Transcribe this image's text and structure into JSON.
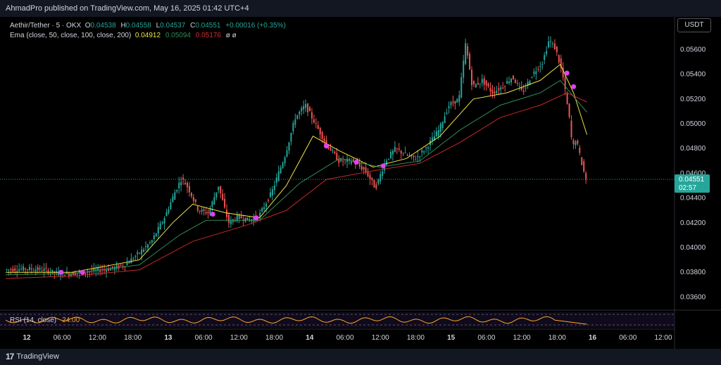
{
  "header": {
    "published": "AhmadPro published on TradingView.com, May 16, 2025 01:42 UTC+4"
  },
  "legend": {
    "symbol": "Aethir/Tether · 5 · OKX",
    "open_label": "O",
    "open": "0.04538",
    "high_label": "H",
    "high": "0.04558",
    "low_label": "L",
    "low": "0.04537",
    "close_label": "C",
    "close": "0.04551",
    "change": "+0.00016 (+0.35%)",
    "ema_label": "Ema (close, 50, close, 100, close, 200)",
    "ema_values": [
      "0.04912",
      "0.05094",
      "0.05176"
    ],
    "ema_extra": "ø ø"
  },
  "currency": "USDT",
  "price_tag": {
    "price": "0.04551",
    "countdown": "02:57"
  },
  "rsi": {
    "label": "RSI (14, close)",
    "value": "24.00"
  },
  "footer": {
    "brand": "TradingView"
  },
  "colors": {
    "up": "#26a69a",
    "down": "#ef5350",
    "ema50": "#f0e442",
    "ema100": "#2e8b57",
    "ema200": "#c62828",
    "signal": "#e040fb",
    "rsi": "#ffa726"
  },
  "chart_data": {
    "type": "line",
    "title": "",
    "ylim": [
      0.035,
      0.0575
    ],
    "y_ticks": [
      "0.05600",
      "0.05400",
      "0.05200",
      "0.05000",
      "0.04800",
      "0.04600",
      "0.04400",
      "0.04200",
      "0.04000",
      "0.03800",
      "0.03600"
    ],
    "x_ticks": [
      "12",
      "06:00",
      "12:00",
      "18:00",
      "13",
      "06:00",
      "12:00",
      "18:00",
      "14",
      "06:00",
      "12:00",
      "18:00",
      "15",
      "06:00",
      "12:00",
      "18:00",
      "16",
      "06:00",
      "12:00"
    ],
    "price_path": [
      [
        0,
        0.0382
      ],
      [
        0.03,
        0.0383
      ],
      [
        0.06,
        0.0382
      ],
      [
        0.08,
        0.0379
      ],
      [
        0.1,
        0.0379
      ],
      [
        0.13,
        0.0381
      ],
      [
        0.16,
        0.0383
      ],
      [
        0.18,
        0.0386
      ],
      [
        0.2,
        0.0395
      ],
      [
        0.22,
        0.0405
      ],
      [
        0.24,
        0.0425
      ],
      [
        0.255,
        0.0445
      ],
      [
        0.265,
        0.0456
      ],
      [
        0.275,
        0.0448
      ],
      [
        0.29,
        0.043
      ],
      [
        0.305,
        0.0428
      ],
      [
        0.32,
        0.045
      ],
      [
        0.335,
        0.042
      ],
      [
        0.35,
        0.0425
      ],
      [
        0.365,
        0.0422
      ],
      [
        0.38,
        0.0425
      ],
      [
        0.4,
        0.0445
      ],
      [
        0.42,
        0.0475
      ],
      [
        0.435,
        0.0505
      ],
      [
        0.45,
        0.0515
      ],
      [
        0.465,
        0.05
      ],
      [
        0.48,
        0.0485
      ],
      [
        0.5,
        0.047
      ],
      [
        0.52,
        0.047
      ],
      [
        0.54,
        0.0462
      ],
      [
        0.555,
        0.0448
      ],
      [
        0.57,
        0.047
      ],
      [
        0.585,
        0.048
      ],
      [
        0.6,
        0.0475
      ],
      [
        0.615,
        0.0472
      ],
      [
        0.63,
        0.048
      ],
      [
        0.65,
        0.0495
      ],
      [
        0.665,
        0.0515
      ],
      [
        0.68,
        0.052
      ],
      [
        0.69,
        0.0565
      ],
      [
        0.7,
        0.053
      ],
      [
        0.715,
        0.0535
      ],
      [
        0.73,
        0.0525
      ],
      [
        0.745,
        0.053
      ],
      [
        0.76,
        0.0538
      ],
      [
        0.775,
        0.0525
      ],
      [
        0.79,
        0.054
      ],
      [
        0.805,
        0.055
      ],
      [
        0.815,
        0.0568
      ],
      [
        0.825,
        0.056
      ],
      [
        0.835,
        0.054
      ],
      [
        0.845,
        0.0505
      ],
      [
        0.85,
        0.048
      ],
      [
        0.855,
        0.0488
      ],
      [
        0.865,
        0.0465
      ],
      [
        0.87,
        0.04551
      ]
    ],
    "series": [
      {
        "name": "Ema 50",
        "values": [
          [
            0,
            0.038
          ],
          [
            0.1,
            0.038
          ],
          [
            0.2,
            0.039
          ],
          [
            0.25,
            0.042
          ],
          [
            0.28,
            0.0435
          ],
          [
            0.33,
            0.0428
          ],
          [
            0.38,
            0.0424
          ],
          [
            0.42,
            0.045
          ],
          [
            0.46,
            0.049
          ],
          [
            0.5,
            0.0478
          ],
          [
            0.55,
            0.0465
          ],
          [
            0.6,
            0.0472
          ],
          [
            0.65,
            0.049
          ],
          [
            0.7,
            0.052
          ],
          [
            0.75,
            0.0525
          ],
          [
            0.8,
            0.0535
          ],
          [
            0.83,
            0.0548
          ],
          [
            0.85,
            0.0525
          ],
          [
            0.87,
            0.04912
          ]
        ]
      },
      {
        "name": "Ema 100",
        "values": [
          [
            0,
            0.0378
          ],
          [
            0.1,
            0.0379
          ],
          [
            0.2,
            0.0386
          ],
          [
            0.26,
            0.041
          ],
          [
            0.3,
            0.0422
          ],
          [
            0.38,
            0.0422
          ],
          [
            0.44,
            0.0452
          ],
          [
            0.5,
            0.0472
          ],
          [
            0.56,
            0.0465
          ],
          [
            0.62,
            0.047
          ],
          [
            0.68,
            0.0495
          ],
          [
            0.74,
            0.0515
          ],
          [
            0.8,
            0.0525
          ],
          [
            0.83,
            0.0535
          ],
          [
            0.85,
            0.0522
          ],
          [
            0.87,
            0.05094
          ]
        ]
      },
      {
        "name": "Ema 200",
        "values": [
          [
            0,
            0.0375
          ],
          [
            0.1,
            0.0377
          ],
          [
            0.2,
            0.0382
          ],
          [
            0.28,
            0.0405
          ],
          [
            0.36,
            0.0418
          ],
          [
            0.42,
            0.043
          ],
          [
            0.48,
            0.0455
          ],
          [
            0.55,
            0.0462
          ],
          [
            0.62,
            0.0468
          ],
          [
            0.68,
            0.0485
          ],
          [
            0.74,
            0.0505
          ],
          [
            0.8,
            0.0515
          ],
          [
            0.84,
            0.0525
          ],
          [
            0.87,
            0.05176
          ]
        ]
      }
    ],
    "signals": [
      [
        0.083,
        0.038
      ],
      [
        0.115,
        0.038
      ],
      [
        0.31,
        0.0427
      ],
      [
        0.375,
        0.0424
      ],
      [
        0.48,
        0.0482
      ],
      [
        0.525,
        0.0469
      ],
      [
        0.565,
        0.0466
      ],
      [
        0.84,
        0.0541
      ],
      [
        0.85,
        0.053
      ]
    ]
  }
}
